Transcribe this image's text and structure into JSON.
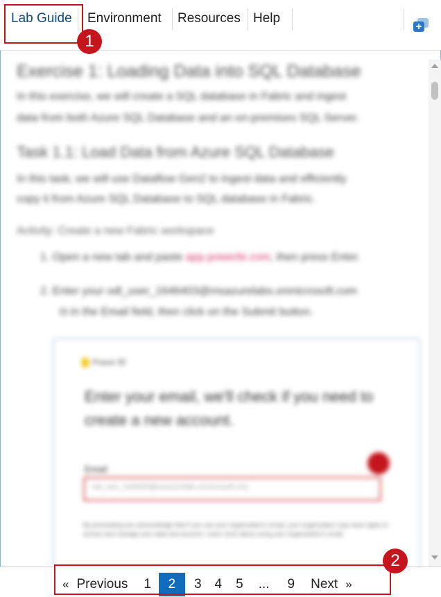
{
  "tabs": [
    {
      "label": "Lab Guide",
      "active": true
    },
    {
      "label": "Environment",
      "active": false
    },
    {
      "label": "Resources",
      "active": false
    },
    {
      "label": "Help",
      "active": false
    }
  ],
  "toolbar": {
    "icon": "copy-add-icon"
  },
  "annotations": {
    "badge1": "1",
    "badge2": "2"
  },
  "content": {
    "title": "Exercise 1: Loading Data into SQL Database",
    "intro_line1": "In this exercise, we will create a SQL database in Fabric and ingest",
    "intro_line2": "data from both Azure SQL Database and an on-premises SQL Server.",
    "task_title": "Task 1.1: Load Data from Azure SQL Database",
    "task_line1": "In this task, we will use Dataflow Gen2 to ingest data and efficiently",
    "task_line2": "copy it from Azure SQL Database to SQL database in Fabric.",
    "activity": "Activity: Create a new Fabric workspace",
    "step1_prefix": "1. Open a new tab and paste",
    "step1_link": "app.powerbi.com",
    "step1_suffix": ", then press Enter.",
    "step2_line1": "2. Enter your odl_user_1646403@msazurelabs.onmicrosoft.com",
    "step2_line2": "in the Email field, then click on the Submit button.",
    "card": {
      "brand": "Power BI",
      "heading": "Enter your email, we'll check if you need to create a new account.",
      "email_label": "Email",
      "email_value": "odl_user_1646403@msazurelabs.onmicrosoft.com",
      "fine_print": "By proceeding you acknowledge that if you use your organization's email, your organization may have rights to access and manage your data and account. Learn more about using your organization's email."
    }
  },
  "pagination": {
    "prev_arrow": "«",
    "previous": "Previous",
    "pages": [
      "1",
      "2",
      "3",
      "4",
      "5",
      "...",
      "9"
    ],
    "current": "2",
    "next": "Next",
    "next_arrow": "»"
  },
  "colors": {
    "accent": "#0f6cbd",
    "annotation_red": "#c4161c",
    "active_tab_text": "#0f4c81"
  }
}
